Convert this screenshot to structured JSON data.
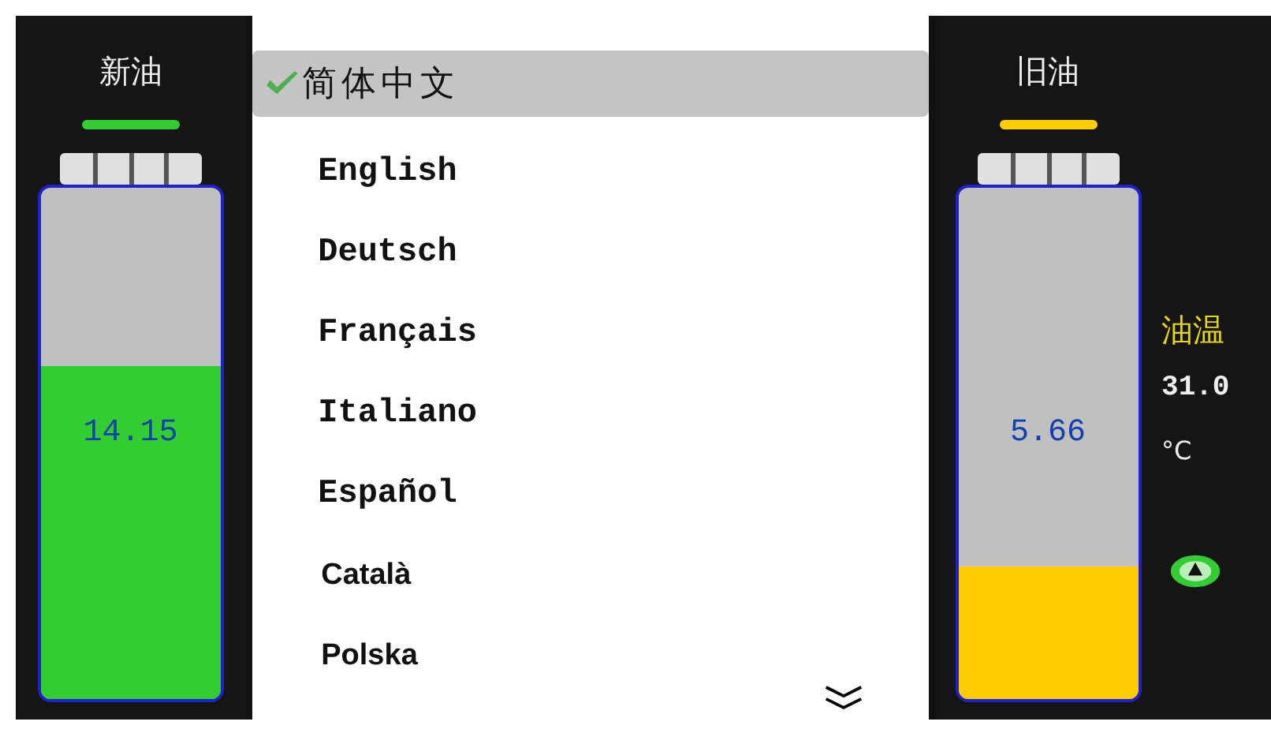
{
  "new_oil": {
    "title": "新油",
    "color": "#33cc33",
    "level": 0.65,
    "reading": "14.15"
  },
  "languages": [
    {
      "label": "简体中文",
      "selected": true,
      "kind": "cjk"
    },
    {
      "label": "English",
      "selected": false,
      "kind": "mono"
    },
    {
      "label": "Deutsch",
      "selected": false,
      "kind": "mono"
    },
    {
      "label": "Français",
      "selected": false,
      "kind": "mono"
    },
    {
      "label": "Italiano",
      "selected": false,
      "kind": "mono"
    },
    {
      "label": "Español",
      "selected": false,
      "kind": "mono"
    },
    {
      "label": "Català",
      "selected": false,
      "kind": "sans"
    },
    {
      "label": "Polska",
      "selected": false,
      "kind": "sans"
    }
  ],
  "old_oil": {
    "title": "旧油",
    "color": "#ffcc00",
    "level": 0.26,
    "reading": "5.66"
  },
  "oil_temp": {
    "label": "油温",
    "value": "31.0",
    "unit": "°C"
  }
}
